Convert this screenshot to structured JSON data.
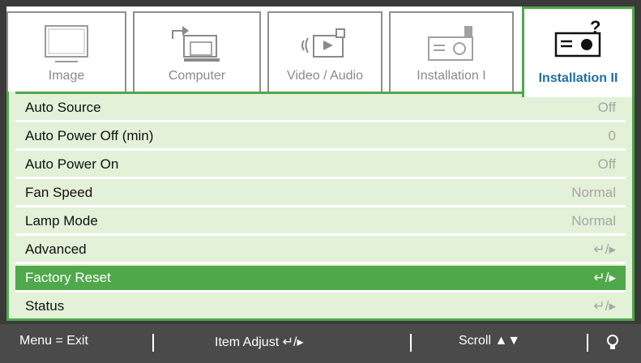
{
  "tabs": [
    {
      "label": "Image",
      "icon": "monitor-icon",
      "active": false
    },
    {
      "label": "Computer",
      "icon": "computer-icon",
      "active": false
    },
    {
      "label": "Video / Audio",
      "icon": "video-audio-icon",
      "active": false
    },
    {
      "label": "Installation I",
      "icon": "projector-icon",
      "active": false
    },
    {
      "label": "Installation II",
      "icon": "projector-question-icon",
      "active": true
    }
  ],
  "menu": {
    "items": [
      {
        "label": "Auto Source",
        "value": "Off"
      },
      {
        "label": "Auto Power Off (min)",
        "value": "0"
      },
      {
        "label": "Auto Power On",
        "value": "Off"
      },
      {
        "label": "Fan Speed",
        "value": "Normal"
      },
      {
        "label": "Lamp Mode",
        "value": "Normal"
      },
      {
        "label": "Advanced",
        "value": "↵/▸"
      },
      {
        "label": "Factory Reset",
        "value": "↵/▸",
        "selected": true
      },
      {
        "label": "Status",
        "value": "↵/▸"
      }
    ]
  },
  "footer": {
    "menu_exit": "Menu = Exit",
    "item_adjust": "Item Adjust ↵/▸",
    "scroll": "Scroll ▲▼",
    "lamp_icon": "lamp-icon"
  },
  "colors": {
    "accent_green": "#4fa84a",
    "menu_bg": "#e2f1d8",
    "active_tab_text": "#1e6ea8",
    "bar_bg": "#4a4a4a"
  }
}
